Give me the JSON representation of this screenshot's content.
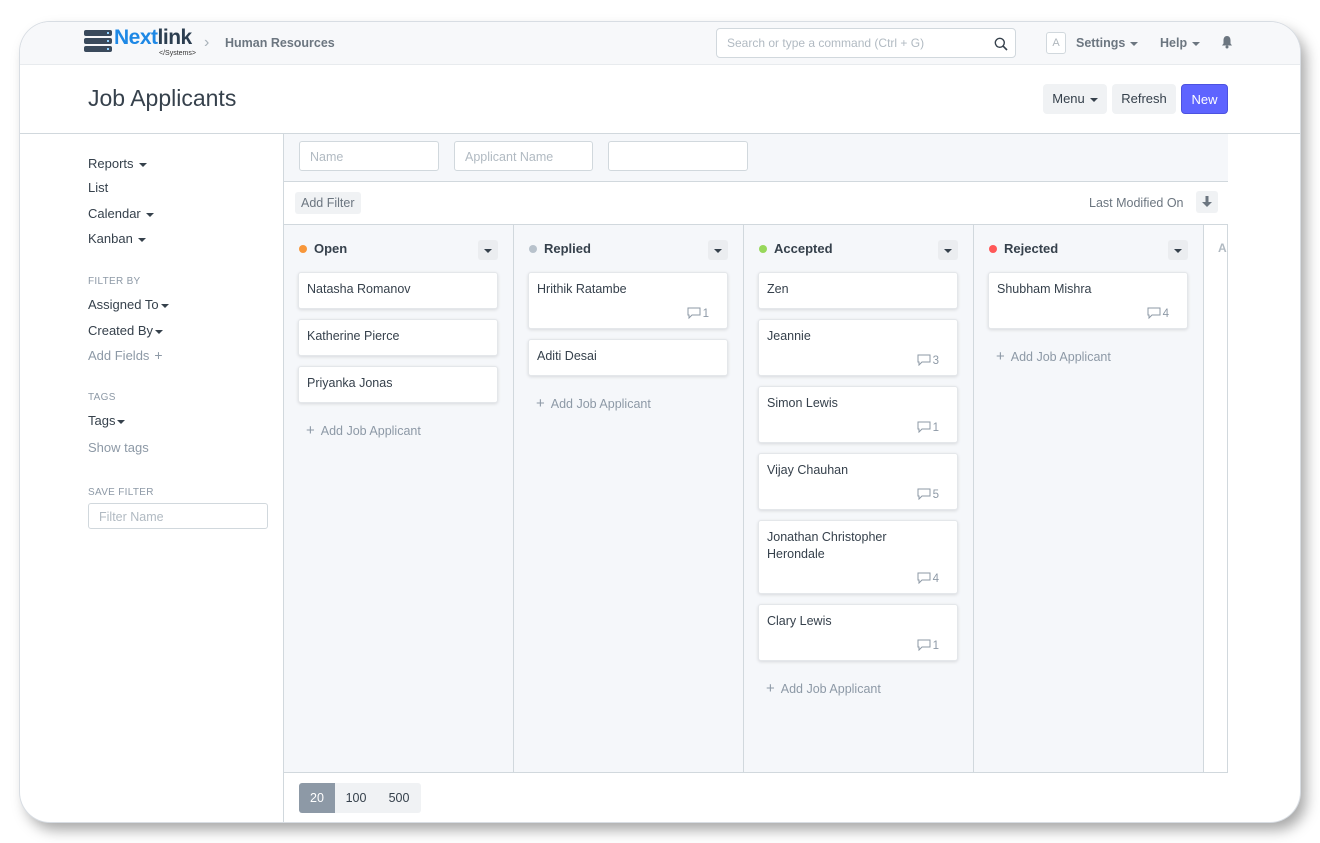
{
  "navbar": {
    "logo_main": "Next",
    "logo_accent": "link",
    "logo_sub": "</Systems>",
    "breadcrumb": "Human Resources",
    "search_placeholder": "Search or type a command (Ctrl + G)",
    "avatar_letter": "A",
    "settings_label": "Settings",
    "help_label": "Help"
  },
  "page": {
    "title": "Job Applicants",
    "menu_label": "Menu",
    "refresh_label": "Refresh",
    "new_label": "New"
  },
  "sidebar": {
    "reports": "Reports",
    "list": "List",
    "calendar": "Calendar",
    "kanban": "Kanban",
    "filter_by_heading": "FILTER BY",
    "assigned_to": "Assigned To",
    "created_by": "Created By",
    "add_fields": "Add Fields",
    "tags_heading": "TAGS",
    "tags": "Tags",
    "show_tags": "Show tags",
    "save_filter_heading": "SAVE FILTER",
    "filter_name_placeholder": "Filter Name"
  },
  "filters": {
    "name_placeholder": "Name",
    "applicant_name_placeholder": "Applicant Name",
    "third_placeholder": "",
    "add_filter": "Add Filter",
    "sort_label": "Last Modified On"
  },
  "kanban": {
    "add_label": "Add Job Applicant",
    "peek_label": "A",
    "columns": [
      {
        "name": "Open",
        "color": "#f8973a",
        "cards": [
          {
            "title": "Natasha Romanov",
            "comments": ""
          },
          {
            "title": "Katherine Pierce",
            "comments": ""
          },
          {
            "title": "Priyanka Jonas",
            "comments": ""
          }
        ]
      },
      {
        "name": "Replied",
        "color": "#b8c2cc",
        "cards": [
          {
            "title": "Hrithik Ratambe",
            "comments": "1"
          },
          {
            "title": "Aditi Desai",
            "comments": ""
          }
        ]
      },
      {
        "name": "Accepted",
        "color": "#98d85b",
        "cards": [
          {
            "title": "Zen",
            "comments": ""
          },
          {
            "title": "Jeannie",
            "comments": "3"
          },
          {
            "title": "Simon Lewis",
            "comments": "1"
          },
          {
            "title": "Vijay Chauhan",
            "comments": "5"
          },
          {
            "title": "Jonathan Christopher Herondale",
            "comments": "4"
          },
          {
            "title": "Clary Lewis",
            "comments": "1"
          }
        ]
      },
      {
        "name": "Rejected",
        "color": "#ff5858",
        "cards": [
          {
            "title": "Shubham Mishra",
            "comments": "4"
          }
        ]
      }
    ]
  },
  "paging": {
    "options": [
      "20",
      "100",
      "500"
    ],
    "selected": "20"
  },
  "colors": {
    "primary": "#5e64ff",
    "border": "#d1d8dd",
    "muted": "#8d99a6"
  }
}
